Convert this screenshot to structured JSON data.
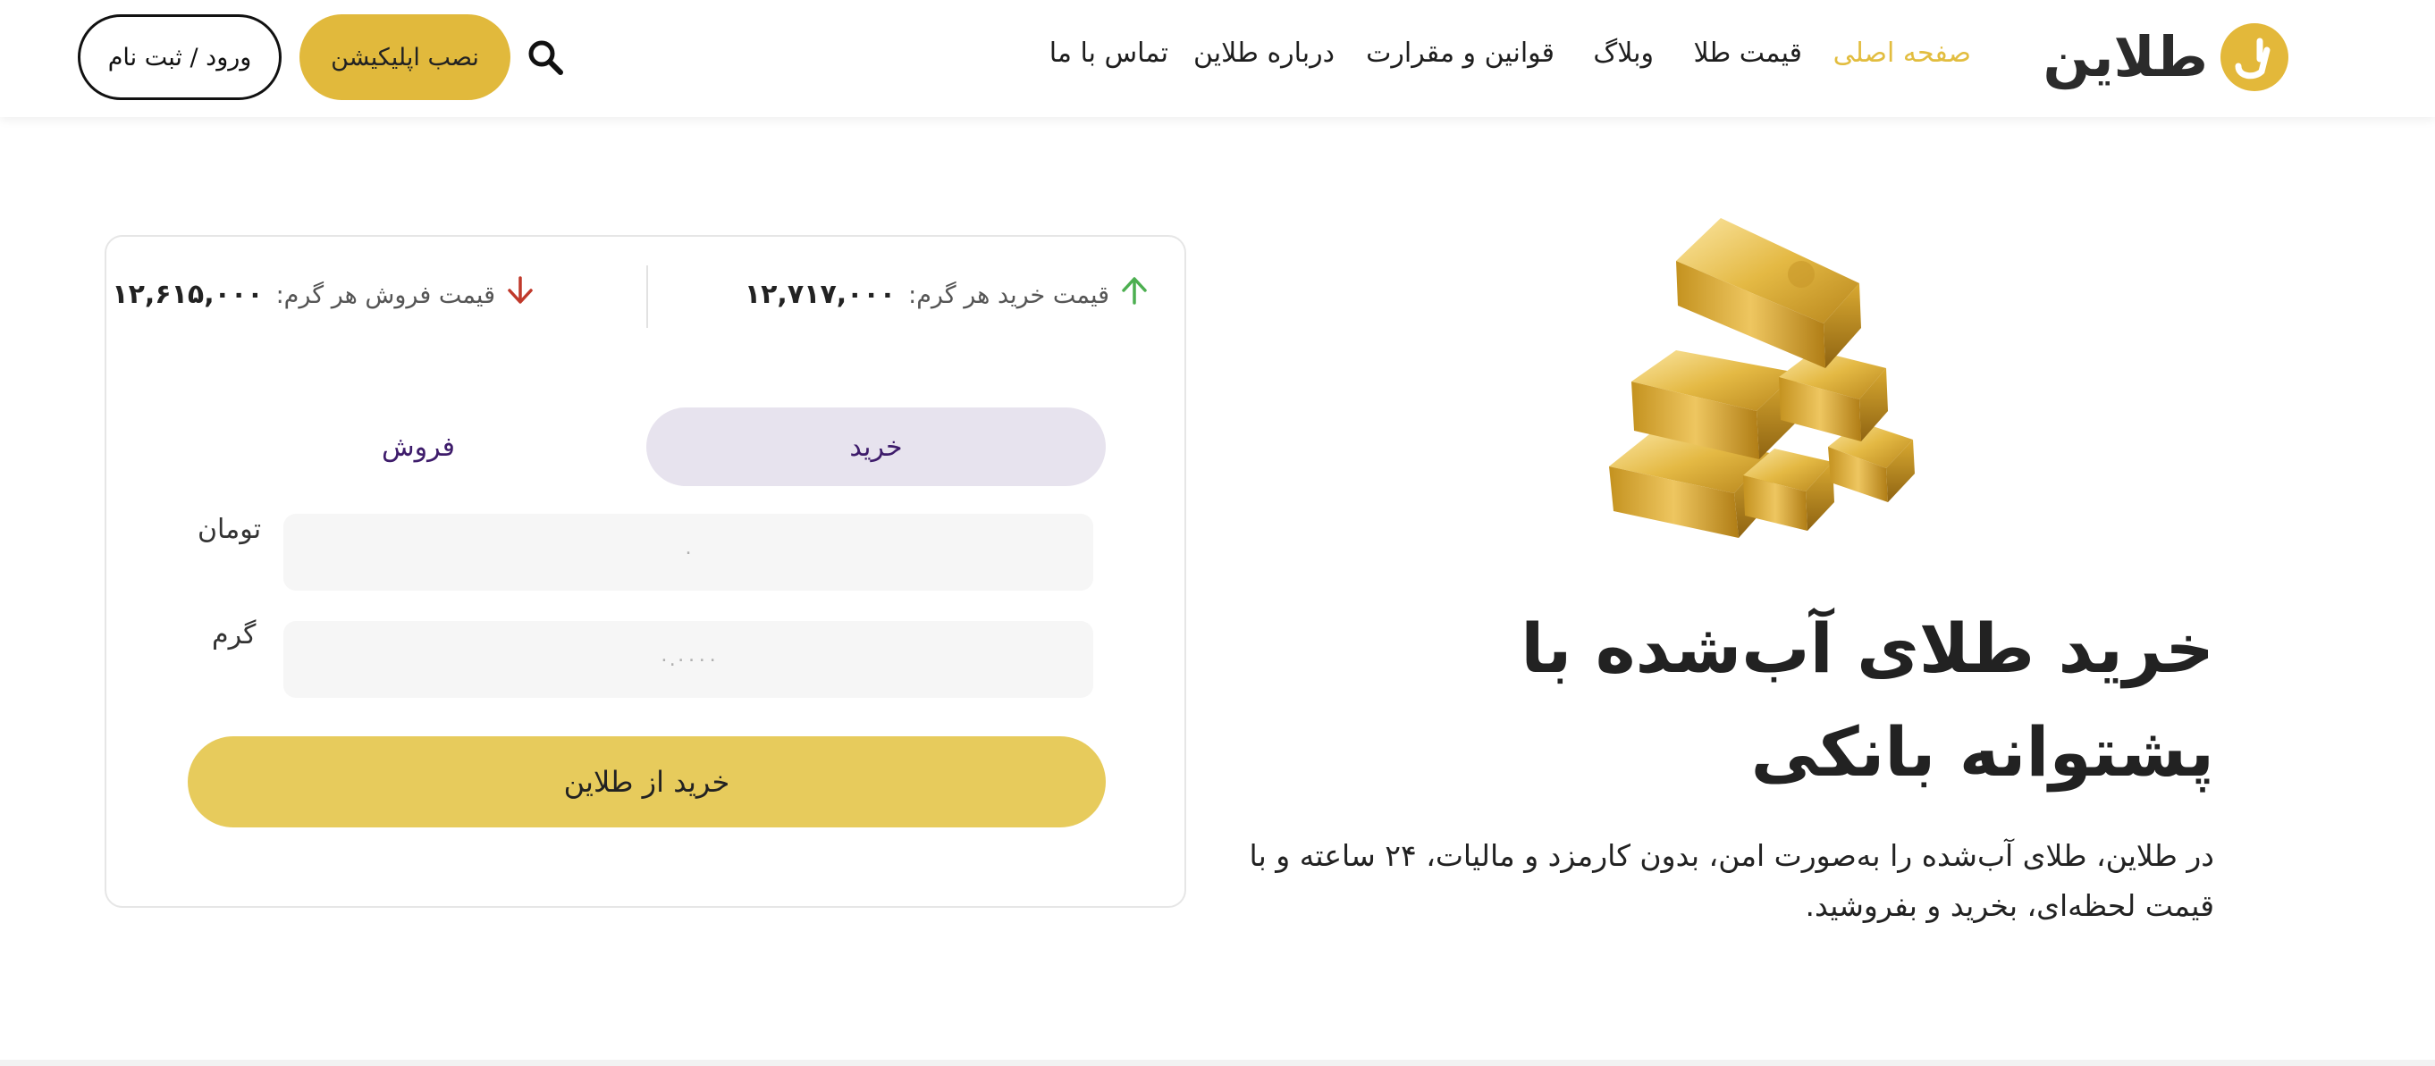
{
  "header": {
    "logo_text": "طلاین",
    "nav": {
      "home": "صفحه اصلی",
      "gold_price": "قیمت طلا",
      "blog": "وبلاگ",
      "rules": "قوانین و مقرارت",
      "about": "درباره طلاین",
      "contact": "تماس با ما"
    },
    "install_app": "نصب اپلیکیشن",
    "login": "ورود / ثبت نام",
    "colors": {
      "accent": "#e2bd3f",
      "button": "#e1b93c"
    }
  },
  "trade_card": {
    "buy_price_label": "قیمت خرید هر گرم:",
    "buy_price_value": "۱۲,۷۱۷,۰۰۰",
    "sell_price_label": "قیمت فروش هر گرم:",
    "sell_price_value": "۱۲,۶۱۵,۰۰۰",
    "tab_buy": "خرید",
    "tab_sell": "فروش",
    "toman_label": "تومان",
    "toman_placeholder": "۰",
    "gram_label": "گرم",
    "gram_placeholder": "۰.۰۰۰۰",
    "submit": "خرید از طلاین",
    "colors": {
      "up_arrow": "#4caf50",
      "down_arrow": "#c0392b",
      "tab_active_bg": "#e7e3ee",
      "submit_bg": "#e7cb5c"
    }
  },
  "hero": {
    "title": "خرید طلای آب‌شده با پشتوانه بانکی",
    "description": "در طلاین، طلای آب‌شده را به‌صورت امن، بدون کارمزد و مالیات، ۲۴ ساعته و با قیمت لحظه‌ای، بخرید و بفروشید."
  }
}
